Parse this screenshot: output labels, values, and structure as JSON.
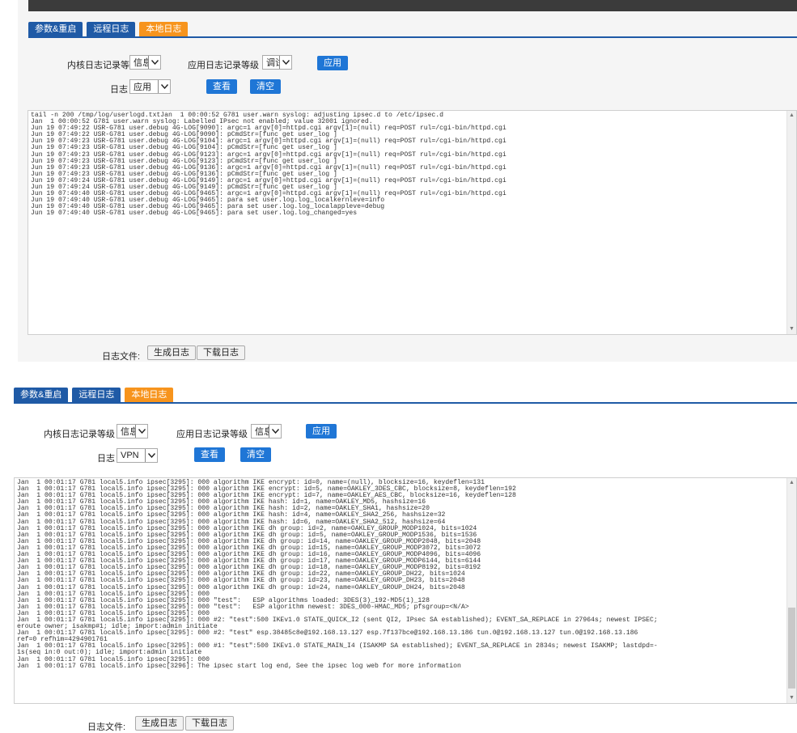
{
  "colors": {
    "tab_blue": "#1f5aa6",
    "tab_active_orange": "#f7941d",
    "button_blue": "#1f76d6",
    "topbar": "#3b3b3b"
  },
  "panel1": {
    "tabs": [
      "参数&重启",
      "远程日志",
      "本地日志"
    ],
    "active_tab": "本地日志",
    "kernel_level_label": "内核日志记录等级",
    "kernel_level_value": "信息",
    "app_level_label": "应用日志记录等级",
    "app_level_value": "调试",
    "apply_label": "应用",
    "log_label": "日志",
    "log_value": "应用",
    "view_label": "查看",
    "clear_label": "清空",
    "log_text": "tail -n 200 /tmp/log/userlogd.txtJan  1 00:00:52 G781 user.warn syslog: adjusting ipsec.d to /etc/ipsec.d\nJan  1 00:00:52 G781 user.warn syslog: Labelled IPsec not enabled; value 32001 ignored.\nJun 19 07:49:22 USR-G781 user.debug 4G-LOG[9090]: argc=1 argv[0]=httpd.cgi argv[1]=(null) req=POST rul=/cgi-bin/httpd.cgi\nJun 19 07:49:22 USR-G781 user.debug 4G-LOG[9090]: pCmdStr=[func get user_log ]\nJun 19 07:49:23 USR-G781 user.debug 4G-LOG[9104]: argc=1 argv[0]=httpd.cgi argv[1]=(null) req=POST rul=/cgi-bin/httpd.cgi\nJun 19 07:49:23 USR-G781 user.debug 4G-LOG[9104]: pCmdStr=[func get user_log ]\nJun 19 07:49:23 USR-G781 user.debug 4G-LOG[9123]: argc=1 argv[0]=httpd.cgi argv[1]=(null) req=POST rul=/cgi-bin/httpd.cgi\nJun 19 07:49:23 USR-G781 user.debug 4G-LOG[9123]: pCmdStr=[func get user_log ]\nJun 19 07:49:23 USR-G781 user.debug 4G-LOG[9136]: argc=1 argv[0]=httpd.cgi argv[1]=(null) req=POST rul=/cgi-bin/httpd.cgi\nJun 19 07:49:23 USR-G781 user.debug 4G-LOG[9136]: pCmdStr=[func get user_log ]\nJun 19 07:49:24 USR-G781 user.debug 4G-LOG[9149]: argc=1 argv[0]=httpd.cgi argv[1]=(null) req=POST rul=/cgi-bin/httpd.cgi\nJun 19 07:49:24 USR-G781 user.debug 4G-LOG[9149]: pCmdStr=[func get user_log ]\nJun 19 07:49:40 USR-G781 user.debug 4G-LOG[9465]: argc=1 argv[0]=httpd.cgi argv[1]=(null) req=POST rul=/cgi-bin/httpd.cgi\nJun 19 07:49:40 USR-G781 user.debug 4G-LOG[9465]: para set user.log.log_localkernleve=info\nJun 19 07:49:40 USR-G781 user.debug 4G-LOG[9465]: para set user.log.log_localappleve=debug\nJun 19 07:49:40 USR-G781 user.debug 4G-LOG[9465]: para set user.log.log_changed=yes",
    "log_file_label": "日志文件:",
    "generate_label": "生成日志",
    "download_label": "下载日志"
  },
  "panel2": {
    "tabs": [
      "参数&重启",
      "远程日志",
      "本地日志"
    ],
    "active_tab": "本地日志",
    "kernel_level_label": "内核日志记录等级",
    "kernel_level_value": "信息",
    "app_level_label": "应用日志记录等级",
    "app_level_value": "信息",
    "apply_label": "应用",
    "log_label": "日志",
    "log_value": "VPN",
    "view_label": "查看",
    "clear_label": "清空",
    "log_text": "Jan  1 00:01:17 G781 local5.info ipsec[3295]: 000 algorithm IKE encrypt: id=0, name=(null), blocksize=16, keydeflen=131\nJan  1 00:01:17 G781 local5.info ipsec[3295]: 000 algorithm IKE encrypt: id=5, name=OAKLEY_3DES_CBC, blocksize=8, keydeflen=192\nJan  1 00:01:17 G781 local5.info ipsec[3295]: 000 algorithm IKE encrypt: id=7, name=OAKLEY_AES_CBC, blocksize=16, keydeflen=128\nJan  1 00:01:17 G781 local5.info ipsec[3295]: 000 algorithm IKE hash: id=1, name=OAKLEY_MD5, hashsize=16\nJan  1 00:01:17 G781 local5.info ipsec[3295]: 000 algorithm IKE hash: id=2, name=OAKLEY_SHA1, hashsize=20\nJan  1 00:01:17 G781 local5.info ipsec[3295]: 000 algorithm IKE hash: id=4, name=OAKLEY_SHA2_256, hashsize=32\nJan  1 00:01:17 G781 local5.info ipsec[3295]: 000 algorithm IKE hash: id=6, name=OAKLEY_SHA2_512, hashsize=64\nJan  1 00:01:17 G781 local5.info ipsec[3295]: 000 algorithm IKE dh group: id=2, name=OAKLEY_GROUP_MODP1024, bits=1024\nJan  1 00:01:17 G781 local5.info ipsec[3295]: 000 algorithm IKE dh group: id=5, name=OAKLEY_GROUP_MODP1536, bits=1536\nJan  1 00:01:17 G781 local5.info ipsec[3295]: 000 algorithm IKE dh group: id=14, name=OAKLEY_GROUP_MODP2048, bits=2048\nJan  1 00:01:17 G781 local5.info ipsec[3295]: 000 algorithm IKE dh group: id=15, name=OAKLEY_GROUP_MODP3072, bits=3072\nJan  1 00:01:17 G781 local5.info ipsec[3295]: 000 algorithm IKE dh group: id=16, name=OAKLEY_GROUP_MODP4096, bits=4096\nJan  1 00:01:17 G781 local5.info ipsec[3295]: 000 algorithm IKE dh group: id=17, name=OAKLEY_GROUP_MODP6144, bits=6144\nJan  1 00:01:17 G781 local5.info ipsec[3295]: 000 algorithm IKE dh group: id=18, name=OAKLEY_GROUP_MODP8192, bits=8192\nJan  1 00:01:17 G781 local5.info ipsec[3295]: 000 algorithm IKE dh group: id=22, name=OAKLEY_GROUP_DH22, bits=1024\nJan  1 00:01:17 G781 local5.info ipsec[3295]: 000 algorithm IKE dh group: id=23, name=OAKLEY_GROUP_DH23, bits=2048\nJan  1 00:01:17 G781 local5.info ipsec[3295]: 000 algorithm IKE dh group: id=24, name=OAKLEY_GROUP_DH24, bits=2048\nJan  1 00:01:17 G781 local5.info ipsec[3295]: 000\nJan  1 00:01:17 G781 local5.info ipsec[3295]: 000 \"test\":   ESP algorithms loaded: 3DES(3)_192-MD5(1)_128\nJan  1 00:01:17 G781 local5.info ipsec[3295]: 000 \"test\":   ESP algorithm newest: 3DES_000-HMAC_MD5; pfsgroup=<N/A>\nJan  1 00:01:17 G781 local5.info ipsec[3295]: 000\nJan  1 00:01:17 G781 local5.info ipsec[3295]: 000 #2: \"test\":500 IKEv1.0 STATE_QUICK_I2 (sent QI2, IPsec SA established); EVENT_SA_REPLACE in 27964s; newest IPSEC;\neroute owner; isakmp#1; idle; import:admin initiate\nJan  1 00:01:17 G781 local5.info ipsec[3295]: 000 #2: \"test\" esp.38485c8e@192.168.13.127 esp.7f137bce@192.168.13.186 tun.0@192.168.13.127 tun.0@192.168.13.186\nref=0 refhim=4294901761\nJan  1 00:01:17 G781 local5.info ipsec[3295]: 000 #1: \"test\":500 IKEv1.0 STATE_MAIN_I4 (ISAKMP SA established); EVENT_SA_REPLACE in 2834s; newest ISAKMP; lastdpd=-\n1s(seq in:0 out:0); idle; import:admin initiate\nJan  1 00:01:17 G781 local5.info ipsec[3295]: 000\nJan  1 00:01:17 G781 local5.info ipsec[3296]: The ipsec start log end, See the ipsec log web for more information",
    "log_file_label": "日志文件:",
    "generate_label": "生成日志",
    "download_label": "下载日志"
  }
}
